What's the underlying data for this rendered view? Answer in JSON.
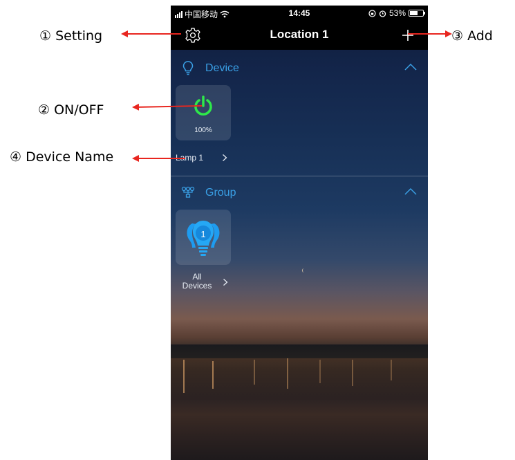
{
  "annotations": {
    "setting": "① Setting",
    "on_off": "② ON/OFF",
    "add": "③ Add",
    "device_name": "④ Device Name"
  },
  "status_bar": {
    "carrier": "中国移动",
    "time": "14:45",
    "battery": "53%"
  },
  "nav": {
    "title": "Location 1",
    "left_icon": "gear-icon",
    "right_icon": "plus-icon"
  },
  "sections": {
    "device": {
      "label": "Device",
      "icon": "bulb-outline-icon",
      "items": [
        {
          "name": "Lamp 1",
          "level": "100%",
          "icon": "power-icon"
        }
      ]
    },
    "group": {
      "label": "Group",
      "icon": "group-nodes-icon",
      "items": [
        {
          "name_line1": "All",
          "name_line2": "Devices",
          "count": "1",
          "icon": "group-bulb-icon"
        }
      ]
    }
  },
  "colors": {
    "accent_blue": "#3aa0e6",
    "power_green": "#2ee84a",
    "arrow_red": "#e8261f"
  }
}
